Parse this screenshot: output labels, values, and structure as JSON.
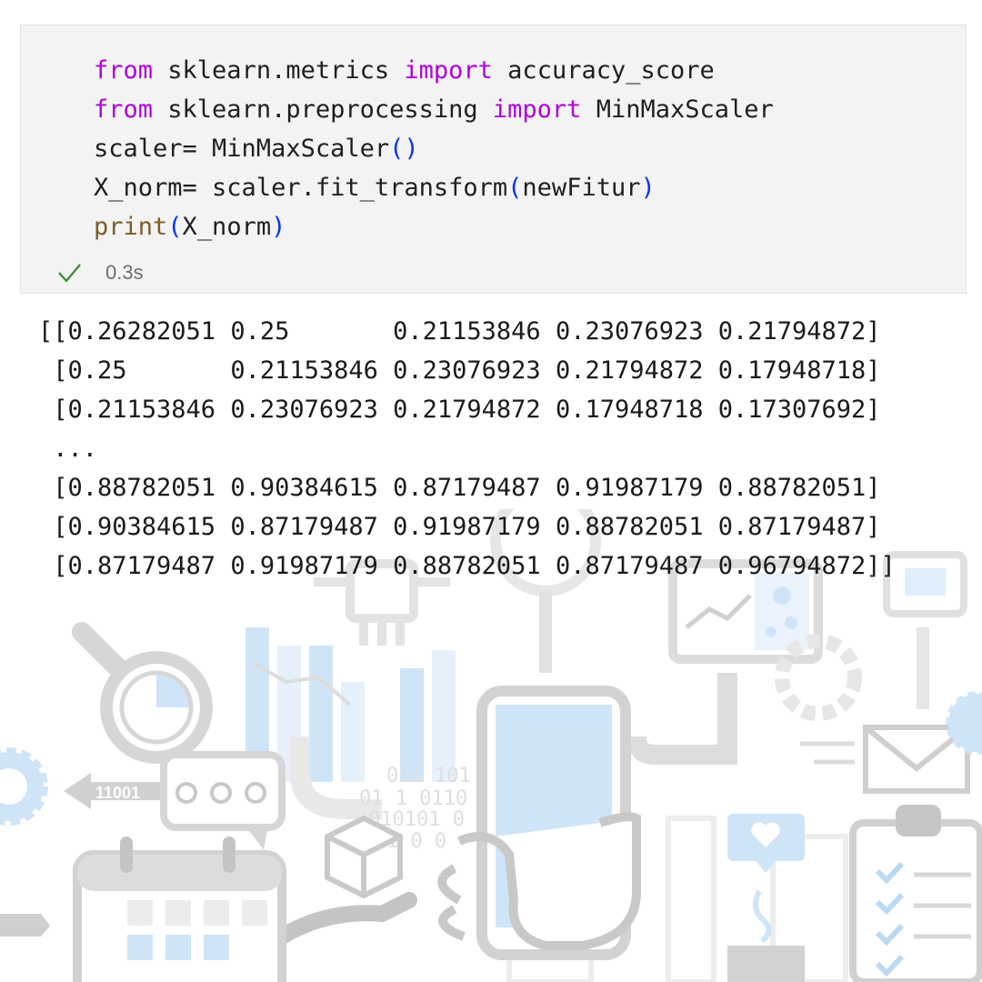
{
  "cell": {
    "code_lines": [
      [
        {
          "t": "from",
          "c": "kw"
        },
        {
          "t": " sklearn.metrics ",
          "c": ""
        },
        {
          "t": "import",
          "c": "kw"
        },
        {
          "t": " accuracy_score",
          "c": ""
        }
      ],
      [
        {
          "t": "from",
          "c": "kw"
        },
        {
          "t": " sklearn.preprocessing ",
          "c": ""
        },
        {
          "t": "import",
          "c": "kw"
        },
        {
          "t": " MinMaxScaler",
          "c": ""
        }
      ],
      [
        {
          "t": "scaler= MinMaxScaler",
          "c": ""
        },
        {
          "t": "()",
          "c": "par"
        }
      ],
      [
        {
          "t": "X_norm= scaler.fit_transform",
          "c": ""
        },
        {
          "t": "(",
          "c": "par"
        },
        {
          "t": "newFitur",
          "c": ""
        },
        {
          "t": ")",
          "c": "par"
        }
      ],
      [
        {
          "t": "print",
          "c": "fn"
        },
        {
          "t": "(",
          "c": "par"
        },
        {
          "t": "X_norm",
          "c": ""
        },
        {
          "t": ")",
          "c": "par"
        }
      ]
    ],
    "status_icon": "check-icon",
    "exec_time": "0.3s"
  },
  "output": {
    "lines": [
      "[[0.26282051 0.25       0.21153846 0.23076923 0.21794872]",
      " [0.25       0.21153846 0.23076923 0.21794872 0.17948718]",
      " [0.21153846 0.23076923 0.21794872 0.17948718 0.17307692]",
      " ...",
      " [0.88782051 0.90384615 0.87179487 0.91987179 0.88782051]",
      " [0.90384615 0.87179487 0.91987179 0.88782051 0.87179487]",
      " [0.87179487 0.91987179 0.88782051 0.87179487 0.96794872]]"
    ]
  },
  "illustration": {
    "binary_label": "11001",
    "binary_digits": [
      "011 101",
      "01 1 0110",
      "010101 0",
      "1 0 0"
    ]
  },
  "colors": {
    "keyword": "#af00db",
    "function": "#795e26",
    "paren": "#0431fa",
    "check": "#388a34",
    "illustration_blue": "#cfe4f7",
    "illustration_gray": "#d6d6d6"
  }
}
